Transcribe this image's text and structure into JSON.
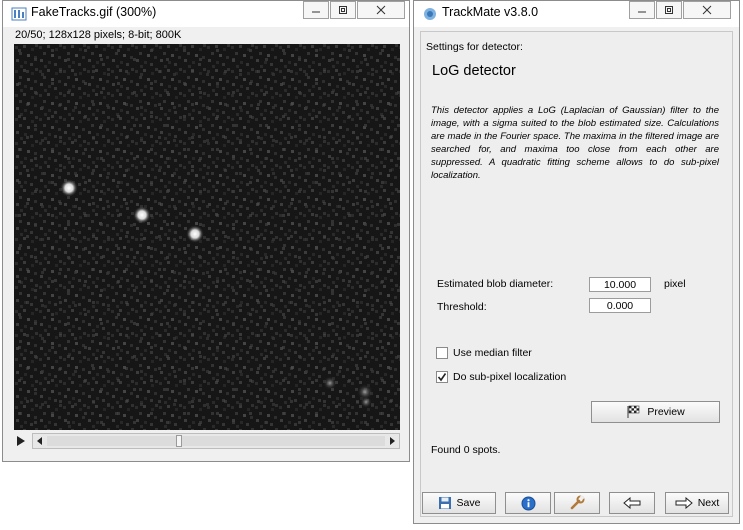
{
  "image_window": {
    "title": "FakeTracks.gif (300%)",
    "info": "20/50; 128x128 pixels; 8-bit; 800K",
    "slider": {
      "current": 20,
      "total": 50
    }
  },
  "trackmate_window": {
    "title": "TrackMate v3.8.0",
    "settings_label": "Settings for detector:",
    "detector_name": "LoG detector",
    "description": "This detector applies a LoG (Laplacian of Gaussian) filter to the image, with a sigma suited to the blob estimated size. Calculations are made in the Fourier space. The maxima in the filtered image are searched for, and maxima too close from each other are suppressed. A quadratic fitting scheme allows to do sub-pixel localization.",
    "fields": {
      "blob_diameter": {
        "label": "Estimated blob diameter:",
        "value": "10.000",
        "unit": "pixel"
      },
      "threshold": {
        "label": "Threshold:",
        "value": "0.000"
      }
    },
    "options": {
      "median_filter": {
        "label": "Use median filter",
        "checked": false
      },
      "subpixel": {
        "label": "Do sub-pixel localization",
        "checked": true
      }
    },
    "preview_label": "Preview",
    "status": "Found 0 spots.",
    "buttons": {
      "save": "Save",
      "next": "Next"
    }
  },
  "colors": {
    "window_bg": "#f0f0f0",
    "image_bg": "#161616",
    "accent_blue": "#1a73c8"
  }
}
